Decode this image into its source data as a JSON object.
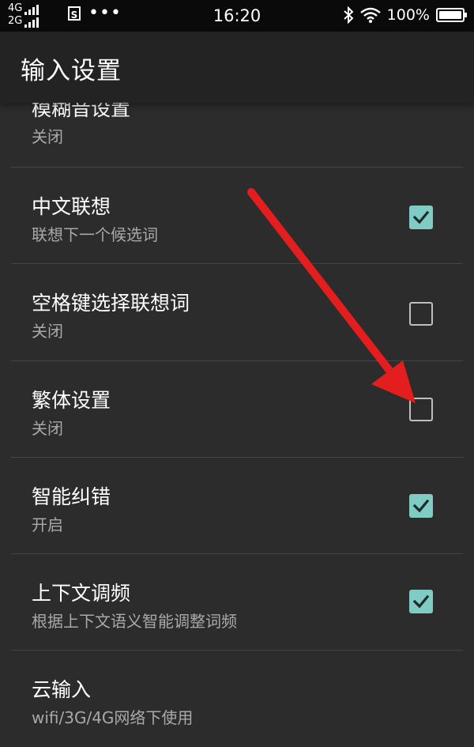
{
  "status_bar": {
    "network_top": "4G",
    "network_bottom": "2G",
    "notif_icon": "S",
    "more": "•••",
    "time": "16:20",
    "battery": "100%"
  },
  "app_bar": {
    "title": "输入设置"
  },
  "settings": [
    {
      "title": "模糊音设置",
      "summary": "关闭",
      "checkbox": null
    },
    {
      "title": "中文联想",
      "summary": "联想下一个候选词",
      "checkbox": true
    },
    {
      "title": "空格键选择联想词",
      "summary": "关闭",
      "checkbox": false
    },
    {
      "title": "繁体设置",
      "summary": "关闭",
      "checkbox": false
    },
    {
      "title": "智能纠错",
      "summary": "开启",
      "checkbox": true
    },
    {
      "title": "上下文调频",
      "summary": "根据上下文语义智能调整词频",
      "checkbox": true
    },
    {
      "title": "云输入",
      "summary": "wifi/3G/4G网络下使用",
      "checkbox": null
    }
  ],
  "colors": {
    "accent": "#80cbc4",
    "background": "#2c2c2c",
    "app_bar": "#232323",
    "arrow": "#e41e1e"
  },
  "icons": [
    "signal-icon",
    "notification-s-icon",
    "more-dots-icon",
    "bluetooth-icon",
    "wifi-icon",
    "battery-icon",
    "check-icon",
    "red-arrow-annotation"
  ]
}
